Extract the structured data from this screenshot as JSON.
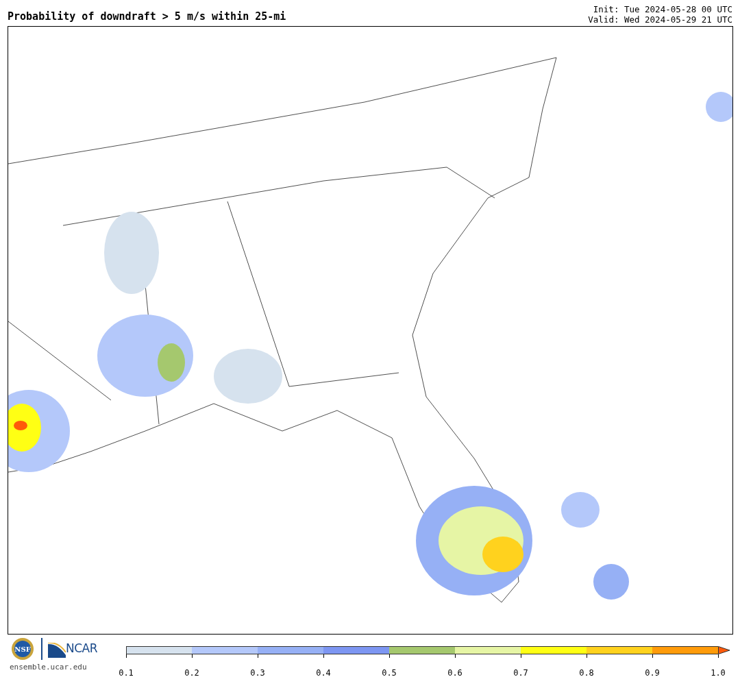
{
  "title": "Probability of downdraft > 5 m/s within 25-mi",
  "init": "Init: Tue 2024-05-28 00 UTC",
  "valid": "Valid: Wed 2024-05-29 21 UTC",
  "logos": {
    "seal_text": "NSF",
    "org_text": "NCAR",
    "site": "ensemble.ucar.edu"
  },
  "colorbar": {
    "bins": [
      {
        "color": "#d6e2ee"
      },
      {
        "color": "#b4c8fa"
      },
      {
        "color": "#96b0f5"
      },
      {
        "color": "#7d96f2"
      },
      {
        "color": "#a5c86e"
      },
      {
        "color": "#e6f5a5"
      },
      {
        "color": "#ffff14"
      },
      {
        "color": "#ffd21e"
      },
      {
        "color": "#ff9b0a"
      }
    ],
    "extend": {
      "color": "#ff5a0a"
    },
    "ticks": [
      "0.1",
      "0.2",
      "0.3",
      "0.4",
      "0.5",
      "0.6",
      "0.7",
      "0.8",
      "0.9",
      "1.0"
    ]
  }
}
